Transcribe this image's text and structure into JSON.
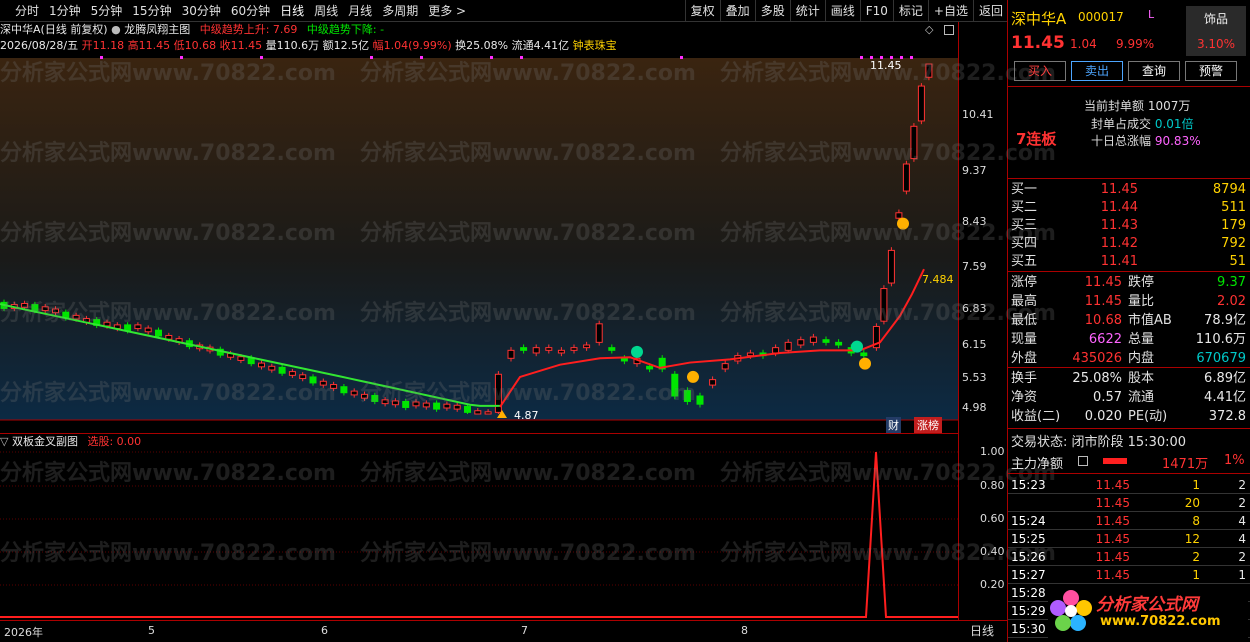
{
  "periods": [
    "分时",
    "1分钟",
    "5分钟",
    "15分钟",
    "30分钟",
    "60分钟",
    "日线",
    "周线",
    "月线",
    "多周期",
    "更多 >"
  ],
  "tools": [
    "复权",
    "叠加",
    "多股",
    "统计",
    "画线",
    "F10",
    "标记",
    "+自选",
    "返回"
  ],
  "info": {
    "stock": "深中华A(日线 前复权)",
    "formula": "龙腾凤翔主图",
    "up_label": "中级趋势上升: 7.69",
    "down_label": "中级趋势下降: -"
  },
  "priceline": {
    "date": "2026/08/28/五",
    "open": "开11.18",
    "high": "高11.45",
    "low": "低10.68",
    "close": "收11.45",
    "vol": "量110.6万",
    "amt": "额12.5亿",
    "chg": "幅1.04(9.99%)",
    "turn": "换25.08%",
    "float": "流通4.41亿",
    "extra": "钟表珠宝"
  },
  "main_axis": [
    "10.41",
    "9.37",
    "8.43",
    "7.59",
    "6.83",
    "6.15",
    "5.53",
    "4.98"
  ],
  "labels": {
    "top_price": "11.45",
    "low_price": "4.87",
    "ma_val": "7.484",
    "cai": "财",
    "zhangbang": "涨榜"
  },
  "sub": {
    "title": "双板金叉副图",
    "select": "选股: 0.00",
    "axis": [
      "1.00",
      "0.80",
      "0.60",
      "0.40",
      "0.20"
    ]
  },
  "xaxis": {
    "year": "2026年",
    "m5": "5",
    "m6": "6",
    "m7": "7",
    "m8": "8",
    "period": "日线"
  },
  "watermark": "分析家公式网www.70822.com",
  "panel": {
    "name": "深中华A",
    "code": "000017",
    "mark": "L",
    "price": "11.45",
    "chg": "1.04",
    "pct": "9.99%",
    "sector": "饰品",
    "sector_pct": "3.10%",
    "buttons": [
      "买入",
      "卖出",
      "查询",
      "预警"
    ],
    "seal_label": "当前封单额",
    "seal_val": "1007万",
    "ratio_label": "封单占成交",
    "ratio_val": "0.01倍",
    "ten_label": "十日总涨幅",
    "ten_val": "90.83%",
    "streak": "7连板",
    "bids": [
      {
        "l": "买一",
        "p": "11.45",
        "v": "8794"
      },
      {
        "l": "买二",
        "p": "11.44",
        "v": "511"
      },
      {
        "l": "买三",
        "p": "11.43",
        "v": "179"
      },
      {
        "l": "买四",
        "p": "11.42",
        "v": "792"
      },
      {
        "l": "买五",
        "p": "11.41",
        "v": "51"
      }
    ],
    "stats": [
      {
        "l1": "涨停",
        "v1": "11.45",
        "l2": "跌停",
        "v2": "9.37"
      },
      {
        "l1": "最高",
        "v1": "11.45",
        "l2": "量比",
        "v2": "2.02"
      },
      {
        "l1": "最低",
        "v1": "10.68",
        "l2": "市值AB",
        "v2": "78.9亿"
      },
      {
        "l1": "现量",
        "v1": "6622",
        "l2": "总量",
        "v2": "110.6万"
      },
      {
        "l1": "外盘",
        "v1": "435026",
        "l2": "内盘",
        "v2": "670679"
      }
    ],
    "stats2": [
      {
        "l1": "换手",
        "v1": "25.08%",
        "l2": "股本",
        "v2": "6.89亿"
      },
      {
        "l1": "净资",
        "v1": "0.57",
        "l2": "流通",
        "v2": "4.41亿"
      },
      {
        "l1": "收益(二)",
        "v1": "0.020",
        "l2": "PE(动)",
        "v2": "372.8"
      }
    ],
    "state": "交易状态: 闭市阶段 15:30:00",
    "main_flow_label": "主力净额",
    "main_flow_val": "1471万",
    "main_flow_pct": "1%",
    "ticks": [
      {
        "t": "15:23",
        "p": "11.45",
        "v": "1",
        "n": "2"
      },
      {
        "t": "",
        "p": "11.45",
        "v": "20",
        "n": "2"
      },
      {
        "t": "15:24",
        "p": "11.45",
        "v": "8",
        "n": "4"
      },
      {
        "t": "15:25",
        "p": "11.45",
        "v": "12",
        "n": "4"
      },
      {
        "t": "15:26",
        "p": "11.45",
        "v": "2",
        "n": "2"
      },
      {
        "t": "15:27",
        "p": "11.45",
        "v": "1",
        "n": "1"
      },
      {
        "t": "15:28",
        "p": "",
        "v": "",
        "n": ""
      },
      {
        "t": "15:29",
        "p": "",
        "v": "",
        "n": ""
      },
      {
        "t": "15:30",
        "p": "",
        "v": "",
        "n": ""
      }
    ],
    "logo": "分析家公式网",
    "logo_url": "www.70822.com"
  },
  "colors": {
    "up": "#ff3232",
    "down": "#00e600",
    "ma_up": "#ff1e1e",
    "ma_down": "#32e632",
    "text": "#e0e0e0",
    "border": "#aa0000"
  }
}
